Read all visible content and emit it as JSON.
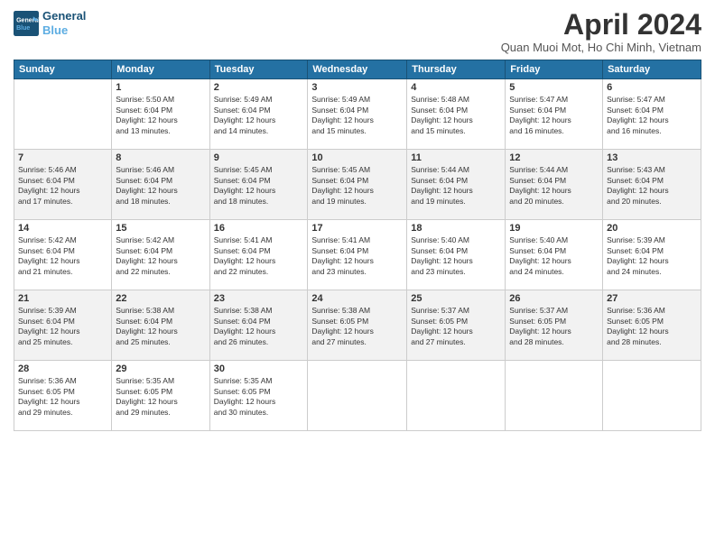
{
  "header": {
    "logo_line1": "General",
    "logo_line2": "Blue",
    "title": "April 2024",
    "location": "Quan Muoi Mot, Ho Chi Minh, Vietnam"
  },
  "days_of_week": [
    "Sunday",
    "Monday",
    "Tuesday",
    "Wednesday",
    "Thursday",
    "Friday",
    "Saturday"
  ],
  "weeks": [
    [
      {
        "day": "",
        "info": ""
      },
      {
        "day": "1",
        "info": "Sunrise: 5:50 AM\nSunset: 6:04 PM\nDaylight: 12 hours\nand 13 minutes."
      },
      {
        "day": "2",
        "info": "Sunrise: 5:49 AM\nSunset: 6:04 PM\nDaylight: 12 hours\nand 14 minutes."
      },
      {
        "day": "3",
        "info": "Sunrise: 5:49 AM\nSunset: 6:04 PM\nDaylight: 12 hours\nand 15 minutes."
      },
      {
        "day": "4",
        "info": "Sunrise: 5:48 AM\nSunset: 6:04 PM\nDaylight: 12 hours\nand 15 minutes."
      },
      {
        "day": "5",
        "info": "Sunrise: 5:47 AM\nSunset: 6:04 PM\nDaylight: 12 hours\nand 16 minutes."
      },
      {
        "day": "6",
        "info": "Sunrise: 5:47 AM\nSunset: 6:04 PM\nDaylight: 12 hours\nand 16 minutes."
      }
    ],
    [
      {
        "day": "7",
        "info": "Sunrise: 5:46 AM\nSunset: 6:04 PM\nDaylight: 12 hours\nand 17 minutes."
      },
      {
        "day": "8",
        "info": "Sunrise: 5:46 AM\nSunset: 6:04 PM\nDaylight: 12 hours\nand 18 minutes."
      },
      {
        "day": "9",
        "info": "Sunrise: 5:45 AM\nSunset: 6:04 PM\nDaylight: 12 hours\nand 18 minutes."
      },
      {
        "day": "10",
        "info": "Sunrise: 5:45 AM\nSunset: 6:04 PM\nDaylight: 12 hours\nand 19 minutes."
      },
      {
        "day": "11",
        "info": "Sunrise: 5:44 AM\nSunset: 6:04 PM\nDaylight: 12 hours\nand 19 minutes."
      },
      {
        "day": "12",
        "info": "Sunrise: 5:44 AM\nSunset: 6:04 PM\nDaylight: 12 hours\nand 20 minutes."
      },
      {
        "day": "13",
        "info": "Sunrise: 5:43 AM\nSunset: 6:04 PM\nDaylight: 12 hours\nand 20 minutes."
      }
    ],
    [
      {
        "day": "14",
        "info": "Sunrise: 5:42 AM\nSunset: 6:04 PM\nDaylight: 12 hours\nand 21 minutes."
      },
      {
        "day": "15",
        "info": "Sunrise: 5:42 AM\nSunset: 6:04 PM\nDaylight: 12 hours\nand 22 minutes."
      },
      {
        "day": "16",
        "info": "Sunrise: 5:41 AM\nSunset: 6:04 PM\nDaylight: 12 hours\nand 22 minutes."
      },
      {
        "day": "17",
        "info": "Sunrise: 5:41 AM\nSunset: 6:04 PM\nDaylight: 12 hours\nand 23 minutes."
      },
      {
        "day": "18",
        "info": "Sunrise: 5:40 AM\nSunset: 6:04 PM\nDaylight: 12 hours\nand 23 minutes."
      },
      {
        "day": "19",
        "info": "Sunrise: 5:40 AM\nSunset: 6:04 PM\nDaylight: 12 hours\nand 24 minutes."
      },
      {
        "day": "20",
        "info": "Sunrise: 5:39 AM\nSunset: 6:04 PM\nDaylight: 12 hours\nand 24 minutes."
      }
    ],
    [
      {
        "day": "21",
        "info": "Sunrise: 5:39 AM\nSunset: 6:04 PM\nDaylight: 12 hours\nand 25 minutes."
      },
      {
        "day": "22",
        "info": "Sunrise: 5:38 AM\nSunset: 6:04 PM\nDaylight: 12 hours\nand 25 minutes."
      },
      {
        "day": "23",
        "info": "Sunrise: 5:38 AM\nSunset: 6:04 PM\nDaylight: 12 hours\nand 26 minutes."
      },
      {
        "day": "24",
        "info": "Sunrise: 5:38 AM\nSunset: 6:05 PM\nDaylight: 12 hours\nand 27 minutes."
      },
      {
        "day": "25",
        "info": "Sunrise: 5:37 AM\nSunset: 6:05 PM\nDaylight: 12 hours\nand 27 minutes."
      },
      {
        "day": "26",
        "info": "Sunrise: 5:37 AM\nSunset: 6:05 PM\nDaylight: 12 hours\nand 28 minutes."
      },
      {
        "day": "27",
        "info": "Sunrise: 5:36 AM\nSunset: 6:05 PM\nDaylight: 12 hours\nand 28 minutes."
      }
    ],
    [
      {
        "day": "28",
        "info": "Sunrise: 5:36 AM\nSunset: 6:05 PM\nDaylight: 12 hours\nand 29 minutes."
      },
      {
        "day": "29",
        "info": "Sunrise: 5:35 AM\nSunset: 6:05 PM\nDaylight: 12 hours\nand 29 minutes."
      },
      {
        "day": "30",
        "info": "Sunrise: 5:35 AM\nSunset: 6:05 PM\nDaylight: 12 hours\nand 30 minutes."
      },
      {
        "day": "",
        "info": ""
      },
      {
        "day": "",
        "info": ""
      },
      {
        "day": "",
        "info": ""
      },
      {
        "day": "",
        "info": ""
      }
    ]
  ]
}
